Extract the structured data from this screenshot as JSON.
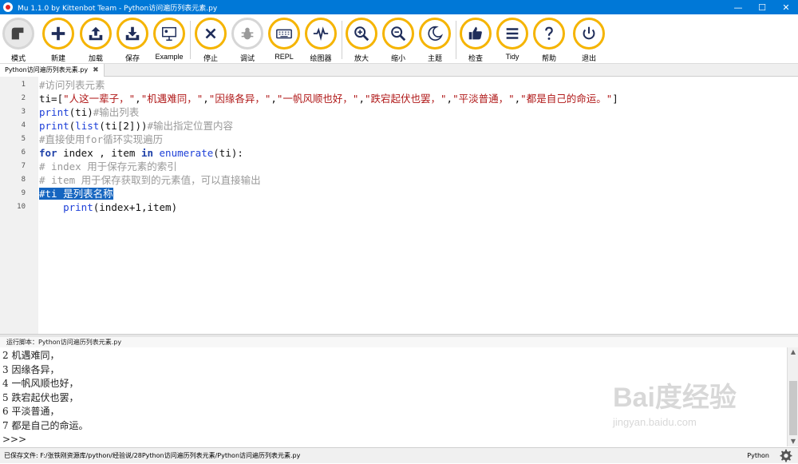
{
  "window": {
    "title": "Mu 1.1.0 by Kittenbot Team - Python访问遍历列表元素.py",
    "controls": {
      "minimize": "—",
      "maximize": "☐",
      "close": "✕"
    }
  },
  "toolbar": {
    "buttons": [
      {
        "id": "mode",
        "label": "模式",
        "icon": "mode-icon"
      },
      {
        "id": "new",
        "label": "新建",
        "icon": "plus-icon"
      },
      {
        "id": "load",
        "label": "加载",
        "icon": "upload-icon"
      },
      {
        "id": "save",
        "label": "保存",
        "icon": "download-icon"
      },
      {
        "id": "example",
        "label": "Example",
        "icon": "presentation-icon"
      },
      {
        "id": "stop",
        "label": "停止",
        "icon": "close-icon"
      },
      {
        "id": "debug",
        "label": "调试",
        "icon": "bug-icon"
      },
      {
        "id": "repl",
        "label": "REPL",
        "icon": "keyboard-icon"
      },
      {
        "id": "plotter",
        "label": "绘图器",
        "icon": "pulse-icon"
      },
      {
        "id": "zoom_in",
        "label": "放大",
        "icon": "zoom-in-icon"
      },
      {
        "id": "zoom_out",
        "label": "缩小",
        "icon": "zoom-out-icon"
      },
      {
        "id": "theme",
        "label": "主题",
        "icon": "moon-icon"
      },
      {
        "id": "check",
        "label": "检查",
        "icon": "thumbs-up-icon"
      },
      {
        "id": "tidy",
        "label": "Tidy",
        "icon": "lines-icon"
      },
      {
        "id": "help",
        "label": "帮助",
        "icon": "question-icon"
      },
      {
        "id": "quit",
        "label": "退出",
        "icon": "power-icon"
      }
    ]
  },
  "tabs": [
    {
      "label": "Python访问遍历列表元素.py",
      "close": "✖"
    }
  ],
  "editor": {
    "line_numbers": [
      "1",
      "2",
      "3",
      "4",
      "5",
      "6",
      "7",
      "8",
      "9",
      "10"
    ],
    "lines": [
      [
        {
          "t": "#访问列表元素",
          "c": "cmt"
        }
      ],
      [
        {
          "t": "ti=[",
          "c": "plain"
        },
        {
          "t": "\"人这一辈子，\"",
          "c": "str"
        },
        {
          "t": ",",
          "c": "plain"
        },
        {
          "t": "\"机遇难同，\"",
          "c": "str"
        },
        {
          "t": ",",
          "c": "plain"
        },
        {
          "t": "\"因缘各异，\"",
          "c": "str"
        },
        {
          "t": ",",
          "c": "plain"
        },
        {
          "t": "\"一帆风顺也好，\"",
          "c": "str"
        },
        {
          "t": ",",
          "c": "plain"
        },
        {
          "t": "\"跌宕起伏也罢，\"",
          "c": "str"
        },
        {
          "t": ",",
          "c": "plain"
        },
        {
          "t": "\"平淡普通，\"",
          "c": "str"
        },
        {
          "t": ",",
          "c": "plain"
        },
        {
          "t": "\"都是自己的命运。\"",
          "c": "str"
        },
        {
          "t": "]",
          "c": "plain"
        }
      ],
      [
        {
          "t": "print",
          "c": "bi"
        },
        {
          "t": "(ti)",
          "c": "plain"
        },
        {
          "t": "#输出列表",
          "c": "cmt"
        }
      ],
      [
        {
          "t": "print",
          "c": "bi"
        },
        {
          "t": "(",
          "c": "plain"
        },
        {
          "t": "list",
          "c": "bi"
        },
        {
          "t": "(ti[",
          "c": "plain"
        },
        {
          "t": "2",
          "c": "plain"
        },
        {
          "t": "]))",
          "c": "plain"
        },
        {
          "t": "#输出指定位置内容",
          "c": "cmt"
        }
      ],
      [
        {
          "t": "#直接使用for循环实现遍历",
          "c": "cmt"
        }
      ],
      [
        {
          "t": "for",
          "c": "kw"
        },
        {
          "t": " index , item ",
          "c": "plain"
        },
        {
          "t": "in",
          "c": "kw"
        },
        {
          "t": " ",
          "c": "plain"
        },
        {
          "t": "enumerate",
          "c": "bi"
        },
        {
          "t": "(ti):",
          "c": "plain"
        }
      ],
      [
        {
          "t": "# index 用于保存元素的索引",
          "c": "cmt"
        }
      ],
      [
        {
          "t": "# item 用于保存获取到的元素值，可以直接输出",
          "c": "cmt"
        }
      ],
      [
        {
          "t": "#ti 是列表名称",
          "c": "sel"
        }
      ],
      [
        {
          "t": "    ",
          "c": "plain"
        },
        {
          "t": "print",
          "c": "bi"
        },
        {
          "t": "(index+1,item)",
          "c": "plain"
        }
      ]
    ]
  },
  "repl": {
    "run_label": "运行脚本：Python访问遍历列表元素.py",
    "output": [
      "2 机遇难同，",
      "3 因缘各异，",
      "4 一帆风顺也好，",
      "5 跌宕起伏也罢，",
      "6 平淡普通，",
      "7 都是自己的命运。",
      ">>> "
    ]
  },
  "status": {
    "saved_path": "已保存文件: F:/张铁刚资源库/python/经验说/28Python访问遍历列表元素/Python访问遍历列表元素.py",
    "mode": "Python"
  },
  "watermark": {
    "brand": "Bai度经验",
    "url": "jingyan.baidu.com"
  },
  "colors": {
    "accent": "#f5b400",
    "titlebar": "#0078d7",
    "selection": "#1565c0"
  }
}
